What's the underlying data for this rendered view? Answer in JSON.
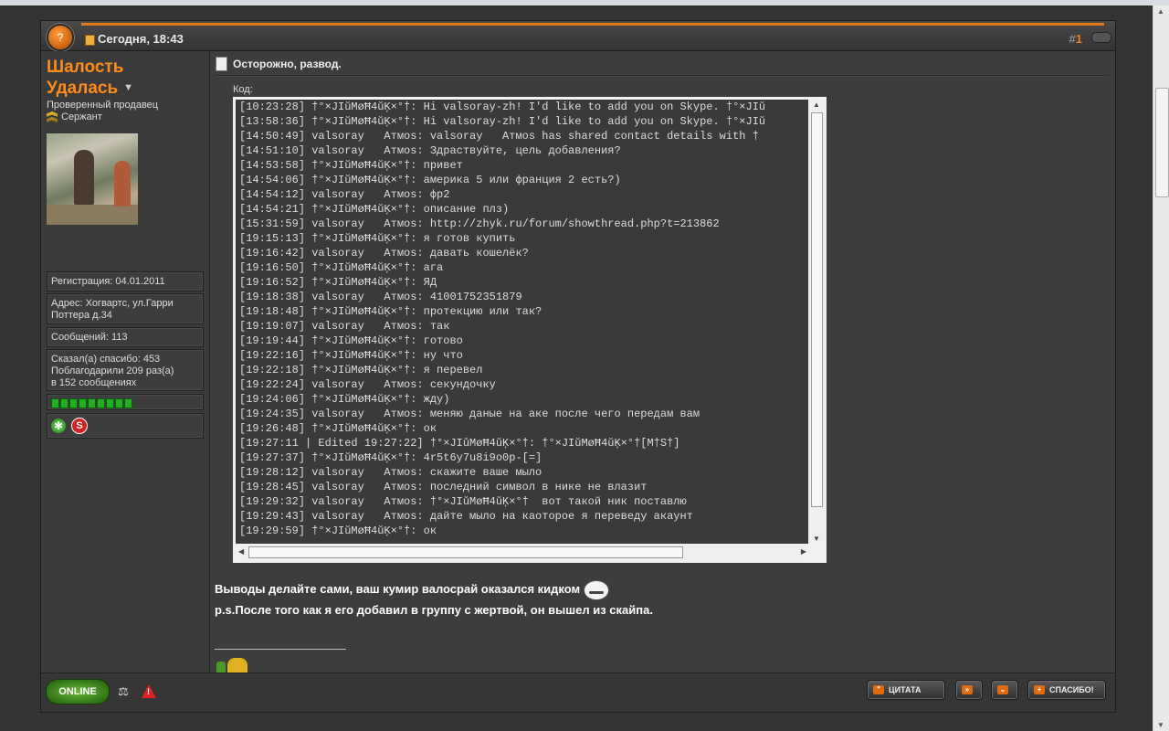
{
  "post": {
    "date": "Сегодня, 18:43",
    "number_prefix": "#",
    "number": "1",
    "title": "Осторожно, развод."
  },
  "user": {
    "name_line1": "Шалость",
    "name_line2": "Удалась",
    "title": "Проверенный продавец",
    "rank": "Сержант",
    "registration": "Регистрация: 04.01.2011",
    "address": "Адрес: Хогвартс, ул.Гарри Поттера д.34",
    "messages": "Сообщений: 113",
    "thanks_line1": "Сказал(а) спасибо: 453",
    "thanks_line2": "Поблагодарили 209 раз(а)",
    "thanks_line3": "в 152 сообщениях",
    "reputation_pips": 9
  },
  "code": {
    "label": "Код:",
    "lines": [
      "[10:23:28] †°×JIŭМøĦ4ŭĶ×°†: Hi valsoray-zh! I'd like to add you on Skype. †°×JIŭ",
      "[13:58:36] †°×JIŭМøĦ4ŭĶ×°†: Hi valsoray-zh! I'd like to add you on Skype. †°×JIŭ",
      "[14:50:49] valsoray   Атмоs: valsoray   Атмоs has shared contact details with †",
      "[14:51:10] valsoray   Атмоs: Здраствуйте, цель добавления?",
      "[14:53:58] †°×JIŭМøĦ4ŭĶ×°†: привет",
      "[14:54:06] †°×JIŭМøĦ4ŭĶ×°†: америка 5 или франция 2 есть?)",
      "[14:54:12] valsoray   Атмоs: фр2",
      "[14:54:21] †°×JIŭМøĦ4ŭĶ×°†: описание плз)",
      "[15:31:59] valsoray   Атмоs: http://zhyk.ru/forum/showthread.php?t=213862",
      "[19:15:13] †°×JIŭМøĦ4ŭĶ×°†: я готов купить",
      "[19:16:42] valsoray   Атмоs: давать кошелёк?",
      "[19:16:50] †°×JIŭМøĦ4ŭĶ×°†: ага",
      "[19:16:52] †°×JIŭМøĦ4ŭĶ×°†: ЯД",
      "[19:18:38] valsoray   Атмоs: 41001752351879",
      "[19:18:48] †°×JIŭМøĦ4ŭĶ×°†: протекцию или так?",
      "[19:19:07] valsoray   Атмоs: так",
      "[19:19:44] †°×JIŭМøĦ4ŭĶ×°†: готово",
      "[19:22:16] †°×JIŭМøĦ4ŭĶ×°†: ну что",
      "[19:22:18] †°×JIŭМøĦ4ŭĶ×°†: я перевел",
      "[19:22:24] valsoray   Атмоs: секундочку",
      "[19:24:06] †°×JIŭМøĦ4ŭĶ×°†: жду)",
      "[19:24:35] valsoray   Атмоs: меняю даные на аке после чего передам вам",
      "[19:26:48] †°×JIŭМøĦ4ŭĶ×°†: ок",
      "[19:27:11 | Edited 19:27:22] †°×JIŭМøĦ4ŭĶ×°†: †°×JIŭМøĦ4ŭĶ×°†[M†S†]",
      "[19:27:37] †°×JIŭМøĦ4ŭĶ×°†: 4r5t6y7u8i9o0p-[=]",
      "[19:28:12] valsoray   Атмоs: скажите ваше мыло",
      "[19:28:45] valsoray   Атмоs: последний символ в нике не влазит",
      "[19:29:32] valsoray   Атмоs: †°×JIŭМøĦ4ŭĶ×°†  вот такой ник поставлю",
      "[19:29:43] valsoray   Атмоs: дайте мыло на каоторое я переведу акаунт",
      "[19:29:59] †°×JIŭМøĦ4ŭĶ×°†: ок"
    ]
  },
  "message": {
    "line1": "Выводы делайте сами, ваш кумир валосрай оказался кидком",
    "line2": "p.s.После того как я его добавил в группу с жертвой, он вышел из скайпа."
  },
  "footer": {
    "online": "ONLINE",
    "quote_label": "ЦИТАТА",
    "thanks_label": "СПАСИБО!"
  },
  "icons": {
    "post_menu": "post-menu-icon",
    "date": "document-icon",
    "title": "note-icon",
    "scales": "scales-icon",
    "warning": "warning-icon"
  },
  "colors": {
    "accent": "#ff8c1a",
    "background": "#3d3d3d",
    "code_bg": "#3a3a3a"
  }
}
